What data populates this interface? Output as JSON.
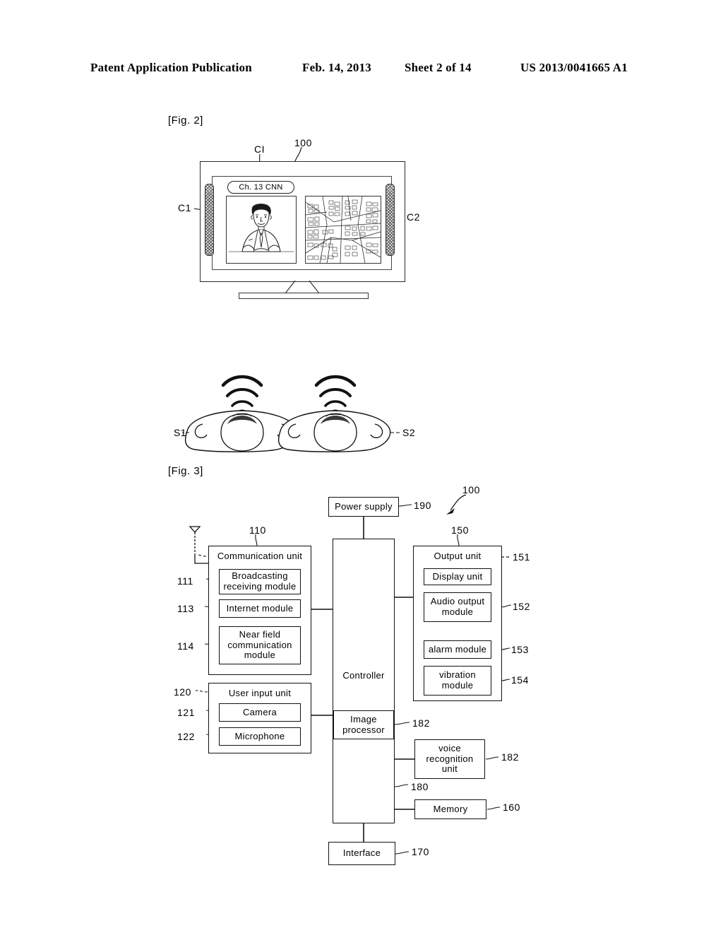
{
  "header": {
    "publication": "Patent Application Publication",
    "date": "Feb. 14, 2013",
    "sheet": "Sheet 2 of 14",
    "patent_number": "US 2013/0041665 A1"
  },
  "figure2": {
    "label": "[Fig. 2]",
    "device_ref": "100",
    "channel_info": {
      "ref": "CI",
      "text": "Ch. 13  CNN"
    },
    "content_left": {
      "ref": "C1",
      "description": "news anchor broadcast image"
    },
    "content_right": {
      "ref": "C2",
      "description": "city map image"
    },
    "speaker_left_ref": "S1",
    "speaker_right_ref": "S2"
  },
  "figure3": {
    "label": "[Fig. 3]",
    "device_ref": "100",
    "power_supply": {
      "label": "Power supply",
      "ref": "190"
    },
    "controller": {
      "label": "Controller",
      "ref": "180"
    },
    "communication_unit": {
      "label": "Communication unit",
      "ref": "110",
      "modules": [
        {
          "label": "Broadcasting\nreceiving module",
          "ref": "111"
        },
        {
          "label": "Internet module",
          "ref": "113"
        },
        {
          "label": "Near field\ncommunication\nmodule",
          "ref": "114"
        }
      ]
    },
    "user_input_unit": {
      "label": "User input unit",
      "ref": "120",
      "modules": [
        {
          "label": "Camera",
          "ref": "121"
        },
        {
          "label": "Microphone",
          "ref": "122"
        }
      ]
    },
    "output_unit": {
      "label": "Output unit",
      "ref": "150",
      "modules": [
        {
          "label": "Display unit",
          "ref": "151"
        },
        {
          "label": "Audio output\nmodule",
          "ref": "152"
        },
        {
          "label": "alarm module",
          "ref": "153"
        },
        {
          "label": "vibration\nmodule",
          "ref": "154"
        }
      ]
    },
    "image_processor": {
      "label": "Image\nprocessor",
      "ref": "182"
    },
    "voice_recognition_unit": {
      "label": "voice\nrecognition\nunit",
      "ref": "182"
    },
    "memory": {
      "label": "Memory",
      "ref": "160"
    },
    "interface": {
      "label": "Interface",
      "ref": "170"
    },
    "antenna": "antenna-symbol"
  }
}
